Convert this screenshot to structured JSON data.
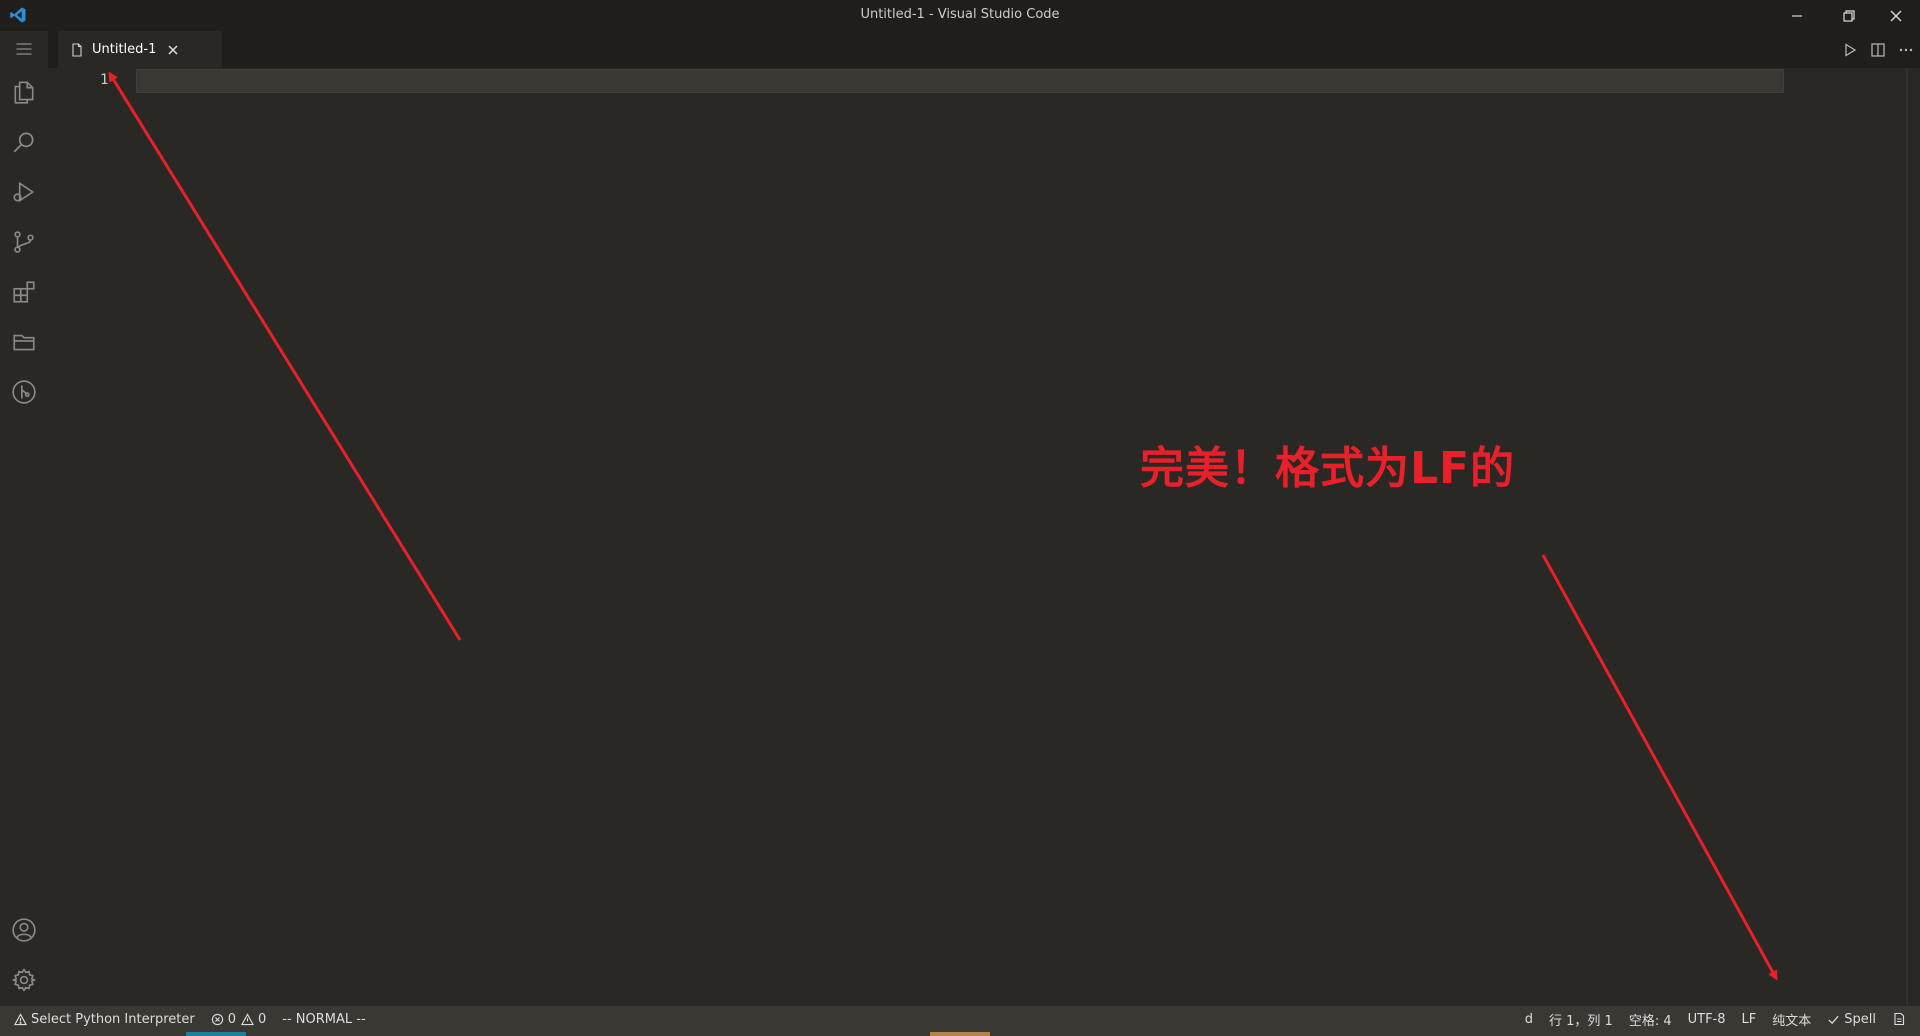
{
  "window": {
    "title": "Untitled-1 - Visual Studio Code"
  },
  "tabs": [
    {
      "label": "Untitled-1"
    }
  ],
  "editor": {
    "line_numbers": [
      "1"
    ]
  },
  "annotation": {
    "text": "完美！格式为LF的",
    "color": "#e8202a"
  },
  "statusbar": {
    "python": "Select Python Interpreter",
    "errors": "0",
    "warnings": "0",
    "vim_mode": "-- NORMAL --",
    "d": "d",
    "position": "行 1，列 1",
    "spaces": "空格: 4",
    "encoding": "UTF-8",
    "eol": "LF",
    "language": "纯文本",
    "spell": "Spell"
  },
  "colors": {
    "accent": "#1f7fa1",
    "annotation": "#e8202a"
  },
  "icons": {
    "activity": [
      "explorer-icon",
      "search-icon",
      "run-debug-icon",
      "source-control-icon",
      "extensions-icon",
      "folder-icon",
      "git-graph-icon",
      "account-icon",
      "settings-gear-icon"
    ]
  }
}
